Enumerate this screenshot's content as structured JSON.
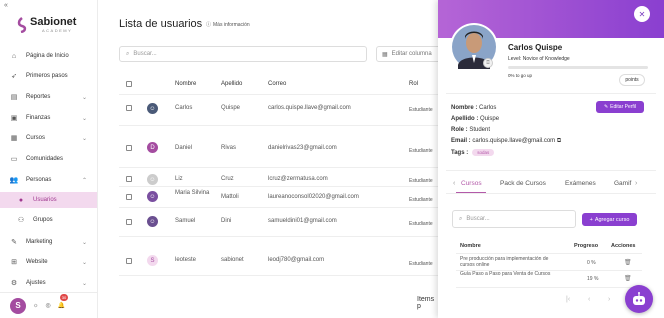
{
  "sidebar": {
    "collapse_icon": "collapse-icon",
    "logo": {
      "name": "Sabionet",
      "sub": "ACADEMY"
    },
    "items": [
      {
        "label": "Página de Inicio",
        "icon": "home-icon"
      },
      {
        "label": "Primeros pasos",
        "icon": "rocket-icon"
      },
      {
        "label": "Reportes",
        "icon": "reports-icon"
      },
      {
        "label": "Finanzas",
        "icon": "finance-icon"
      },
      {
        "label": "Cursos",
        "icon": "courses-icon"
      },
      {
        "label": "Comunidades",
        "icon": "community-icon"
      },
      {
        "label": "Personas",
        "icon": "people-icon"
      },
      {
        "label": "Usuarios",
        "icon": "users-icon"
      },
      {
        "label": "Grupos",
        "icon": "groups-icon"
      },
      {
        "label": "Marketing",
        "icon": "marketing-icon"
      },
      {
        "label": "Website",
        "icon": "website-icon"
      },
      {
        "label": "Ajustes",
        "icon": "settings-icon"
      }
    ],
    "notification_count": "30"
  },
  "main": {
    "title": "Lista de usuarios",
    "more_info": "Más información",
    "search_placeholder": "Buscar...",
    "edit_columns": "Editar columna",
    "headers": {
      "nombre": "Nombre",
      "apellido": "Apellido",
      "correo": "Correo",
      "rol": "Rol"
    },
    "rows": [
      {
        "nombre": "Carlos",
        "apellido": "Quispe",
        "correo": "carlos.quispe.llave@gmail.com",
        "rol": "Estudiante",
        "avatar": "photo"
      },
      {
        "nombre": "Daniel",
        "apellido": "Rivas",
        "correo": "danielrivas23@gmail.com",
        "rol": "Estudiante",
        "avatar": "D"
      },
      {
        "nombre": "Liz",
        "apellido": "Cruz",
        "correo": "lcruz@zermatusa.com",
        "rol": "Estudiante",
        "avatar": "default"
      },
      {
        "nombre": "Maria Silvina",
        "apellido": "Mattoli",
        "correo": "laureanoconsol02020@gmail.com",
        "rol": "Estudiante",
        "avatar": "photo"
      },
      {
        "nombre": "Samuel",
        "apellido": "Dini",
        "correo": "samueldini01@gmail.com",
        "rol": "Estudiante",
        "avatar": "photo"
      },
      {
        "nombre": "leoteste",
        "apellido": "sabionet",
        "correo": "leodj780@gmail.com",
        "rol": "Estudiante",
        "avatar": "logo"
      }
    ],
    "items_per_page": "Items p"
  },
  "panel": {
    "name": "Carlos Quispe",
    "level": "Level: Novice of Knowledge",
    "progress_to_next": 0.0,
    "go_up": "0% to go up",
    "points_label": "points",
    "edit_profile": "Editar Perfil",
    "info": {
      "nombre_label": "Nombre :",
      "nombre": "Carlos",
      "apellido_label": "Apellido :",
      "apellido": "Quispe",
      "role_label": "Role :",
      "role": "Student",
      "email_label": "Email :",
      "email": "carlos.quispe.llave@gmail.com",
      "tags_label": "Tags :",
      "tag": "sodas"
    },
    "tabs": [
      "Cursos",
      "Pack de Cursos",
      "Exámenes",
      "Gamif"
    ],
    "course_search_placeholder": "Buscar...",
    "add_course": "Agregar curso",
    "course_headers": {
      "nombre": "Nombre",
      "progreso": "Progreso",
      "acciones": "Acciones"
    },
    "courses": [
      {
        "nombre": "Pre producción para implementación de cursos online",
        "progreso": "0 %"
      },
      {
        "nombre": "Guía Paso a Paso para Venta de Cursos",
        "progreso": "19 %"
      }
    ]
  },
  "colors": {
    "accent": "#8a3fd0",
    "pink": "#a44ca0",
    "active_bg": "#f3d9ee"
  }
}
